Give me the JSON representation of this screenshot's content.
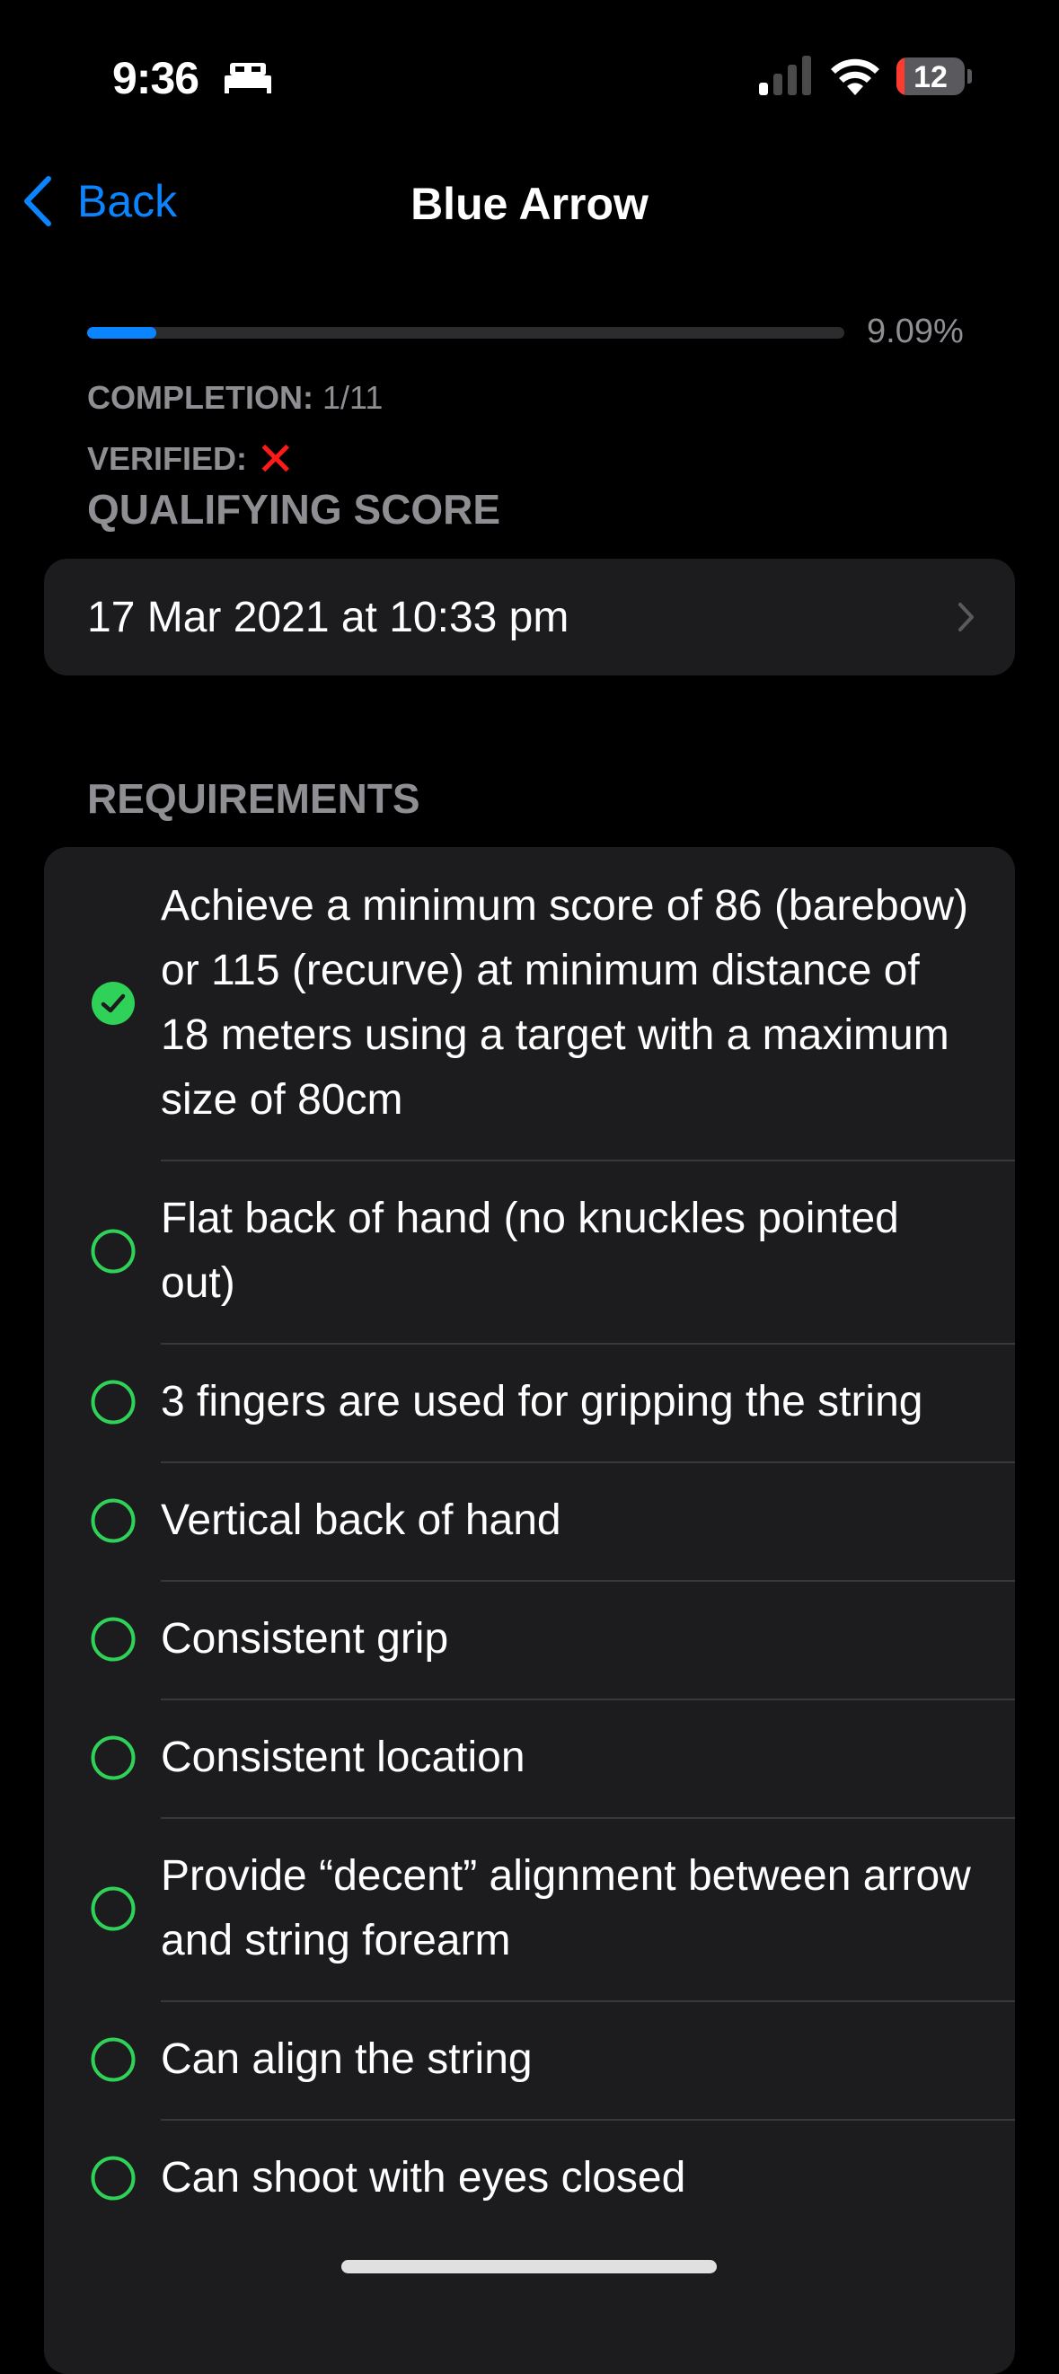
{
  "status_bar": {
    "time": "9:36",
    "battery": "12",
    "icons": [
      "bed-icon",
      "cellular-signal-icon",
      "wifi-icon",
      "battery-icon"
    ]
  },
  "nav": {
    "back_label": "Back",
    "title": "Blue Arrow"
  },
  "progress": {
    "percent": 9.09,
    "label": "9.09%"
  },
  "completion": {
    "label": "COMPLETION:",
    "value": "1/11"
  },
  "verified": {
    "label": "VERIFIED:",
    "value": "❌"
  },
  "qualifying": {
    "header": "QUALIFYING SCORE",
    "date": "17 Mar 2021 at 10:33 pm"
  },
  "requirements": {
    "header": "REQUIREMENTS",
    "items": [
      {
        "text": "Achieve a minimum score of 86 (barebow) or 115 (recurve) at minimum distance of 18 meters using a target with a maximum size of 80cm",
        "done": true
      },
      {
        "text": "Flat back of hand (no knuckles pointed out)",
        "done": false
      },
      {
        "text": "3 fingers are used for gripping the string",
        "done": false
      },
      {
        "text": "Vertical back of hand",
        "done": false
      },
      {
        "text": "Consistent grip",
        "done": false
      },
      {
        "text": "Consistent location",
        "done": false
      },
      {
        "text": "Provide “decent” alignment between arrow and string forearm",
        "done": false
      },
      {
        "text": "Can align the string",
        "done": false
      },
      {
        "text": "Can shoot with eyes closed",
        "done": false
      }
    ]
  },
  "colors": {
    "accent": "#0a84ff",
    "success": "#30d158",
    "error": "#ff1a1a",
    "card": "#1c1c1e",
    "secondary_text": "#8e8e93"
  }
}
